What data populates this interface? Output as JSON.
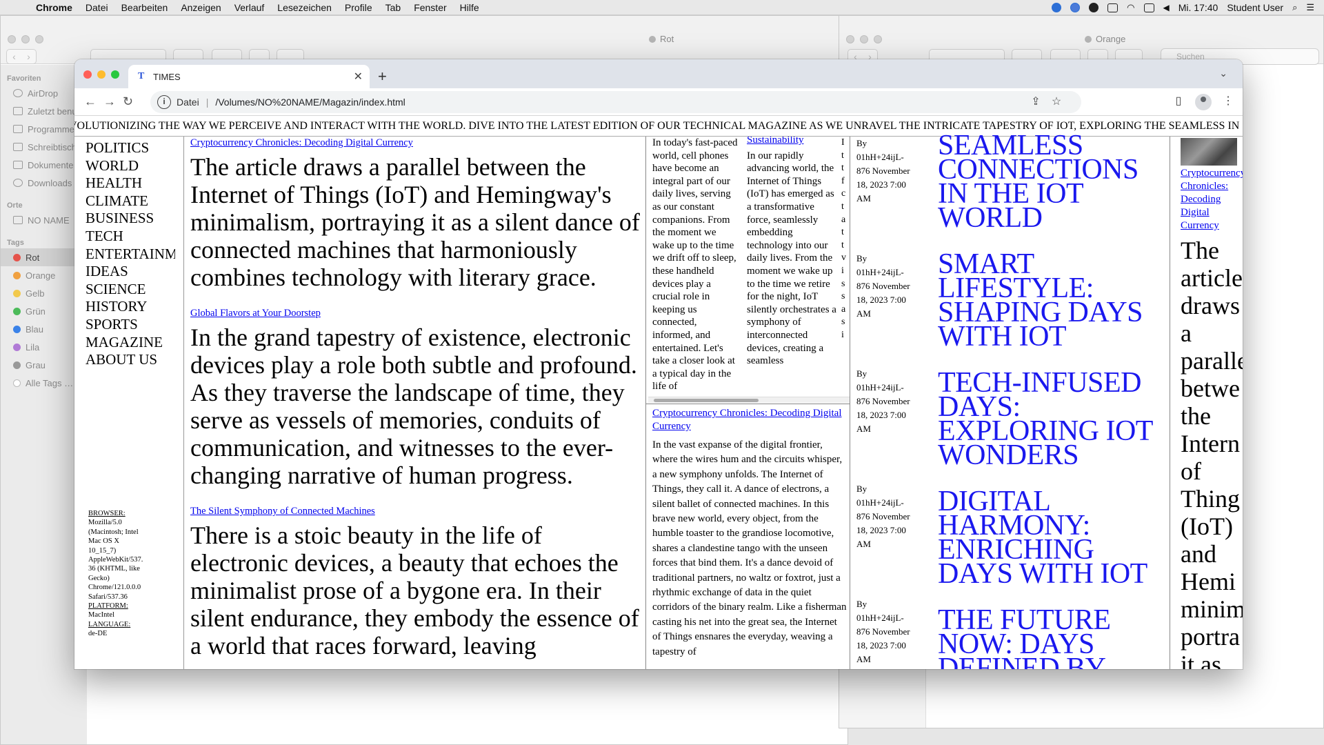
{
  "menubar": {
    "app": "Chrome",
    "items": [
      "Datei",
      "Bearbeiten",
      "Anzeigen",
      "Verlauf",
      "Lesezeichen",
      "Profile",
      "Tab",
      "Fenster",
      "Hilfe"
    ],
    "clock": "Mi. 17:40",
    "user": "Student User"
  },
  "finder_left": {
    "title": "Rot",
    "sidebar": {
      "favorites_label": "Favoriten",
      "favorites": [
        "AirDrop",
        "Zuletzt benutzt",
        "Programme",
        "Schreibtisch",
        "Dokumente",
        "Downloads"
      ],
      "locations_label": "Orte",
      "locations": [
        "NO NAME"
      ],
      "tags_label": "Tags",
      "tags": [
        {
          "label": "Rot",
          "color": "#e5534b"
        },
        {
          "label": "Orange",
          "color": "#f0a040"
        },
        {
          "label": "Gelb",
          "color": "#f2c94c"
        },
        {
          "label": "Grün",
          "color": "#4cbb5a"
        },
        {
          "label": "Blau",
          "color": "#3a82e8"
        },
        {
          "label": "Lila",
          "color": "#b07ad6"
        },
        {
          "label": "Grau",
          "color": "#999999"
        },
        {
          "label": "Alle Tags …",
          "color": "#ffffff"
        }
      ]
    }
  },
  "finder_right": {
    "title": "Orange",
    "search_placeholder": "Suchen"
  },
  "chrome": {
    "tab_title": "TIMES",
    "tab_favicon": "T",
    "url_scheme": "Datei",
    "url": "/Volumes/NO%20NAME/Magazin/index.html"
  },
  "page": {
    "ticker": "VOLUTIONIZING THE WAY WE PERCEIVE AND INTERACT WITH THE WORLD. DIVE INTO THE LATEST EDITION OF OUR TECHNICAL MAGAZINE AS WE UNRAVEL THE INTRICATE TAPESTRY OF IOT, EXPLORING THE SEAMLESS IN",
    "nav": [
      "POLITICS",
      "WORLD",
      "HEALTH",
      "CLIMATE",
      "BUSINESS",
      "TECH",
      "ENTERTAINMENT",
      "IDEAS",
      "SCIENCE",
      "HISTORY",
      "SPORTS",
      "MAGAZINE",
      "ABOUT US"
    ],
    "browser_info": {
      "browser_label": "BROWSER:",
      "browser_value": "Mozilla/5.0 (Macintosh; Intel Mac OS X 10_15_7) AppleWebKit/537.36 (KHTML, like Gecko) Chrome/121.0.0.0 Safari/537.36",
      "platform_label": "PLATFORM:",
      "platform_value": "MacIntel",
      "language_label": "LANGUAGE:",
      "language_value": "de-DE"
    },
    "articles": [
      {
        "link": "Cryptocurrency Chronicles: Decoding Digital Currency",
        "text": "The article draws a parallel between the Internet of Things (IoT) and Hemingway's minimalism, portraying it as a silent dance of connected machines that harmoniously combines technology with literary grace."
      },
      {
        "link": "Global Flavors at Your Doorstep",
        "text": "In the grand tapestry of existence, electronic devices play a role both subtle and profound. As they traverse the landscape of time, they serve as vessels of memories, conduits of communication, and witnesses to the ever-changing narrative of human progress."
      },
      {
        "link": "The Silent Symphony of Connected Machines",
        "text": "There is a stoic beauty in the life of electronic devices, a beauty that echoes the minimalist prose of a bygone era. In their silent endurance, they embody the essence of a world that races forward, leaving"
      }
    ],
    "col3a_text": "In today's fast-paced world, cell phones have become an integral part of our daily lives, serving as our constant companions. From the moment we wake up to the time we drift off to sleep, these handheld devices play a crucial role in keeping us connected, informed, and entertained. Let's take a closer look at a typical day in the life of",
    "col3b_link": "Sustainability",
    "col3b_text": "In our rapidly advancing world, the Internet of Things (IoT) has emerged as a transformative force, seamlessly embedding technology into our daily lives. From the moment we wake up to the time we retire for the night, IoT silently orchestrates a symphony of interconnected devices, creating a seamless",
    "col3c_text": "I t t f c t a t t v i s s a s i",
    "col3bottom_link": "Cryptocurrency Chronicles: Decoding Digital Currency",
    "col3bottom_text": "In the vast expanse of the digital frontier, where the wires hum and the circuits whisper, a new symphony unfolds. The Internet of Things, they call it. A dance of electrons, a silent ballet of connected machines. In this brave new world, every object, from the humble toaster to the grandiose locomotive, shares a clandestine tango with the unseen forces that bind them. It's a dance devoid of traditional partners, no waltz or foxtrot, just a rhythmic exchange of data in the quiet corridors of the binary realm. Like a fisherman casting his net into the great sea, the Internet of Things ensnares the everyday, weaving a tapestry of",
    "bylines": [
      "By 01hH+24ijL-876 November 18, 2023 7:00 AM",
      "By 01hH+24ijL-876 November 18, 2023 7:00 AM",
      "By 01hH+24ijL-876 November 18, 2023 7:00 AM",
      "By 01hH+24ijL-876 November 18, 2023 7:00 AM",
      "By 01hH+24ijL-876 November 18, 2023 7:00 AM"
    ],
    "headlines": [
      "SEAMLESS CONNECTIONS IN THE IOT WORLD",
      "SMART LIFESTYLE: SHAPING DAYS WITH IOT",
      "TECH-INFUSED DAYS: EXPLORING IOT WONDERS",
      "DIGITAL HARMONY: ENRICHING DAYS WITH IOT",
      "THE FUTURE NOW: DAYS DEFINED BY IOT"
    ],
    "col6_link": "Cryptocurrency Chronicles: Decoding Digital Currency",
    "col6_text": [
      "The",
      "article",
      "draws",
      "a",
      "paralle",
      "betwe",
      "the",
      "Intern",
      "of",
      "Thing",
      "(IoT)",
      "and",
      "Hemi",
      "minim",
      "portra",
      "it as"
    ]
  }
}
